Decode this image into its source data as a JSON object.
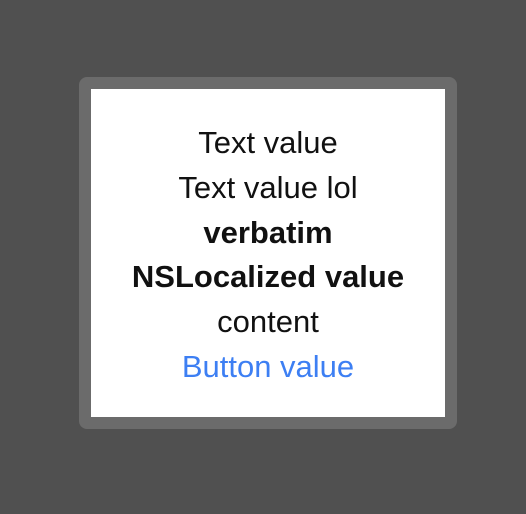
{
  "content": {
    "text_value": "Text value",
    "text_value_lol": "Text value lol",
    "verbatim": "verbatim",
    "nslocalized_value": "NSLocalized value",
    "content_text": "content",
    "button_label": "Button value"
  },
  "colors": {
    "background": "#505050",
    "frame": "#6b6b6b",
    "screen": "#ffffff",
    "text": "#111111",
    "accent": "#3d7ff3"
  }
}
